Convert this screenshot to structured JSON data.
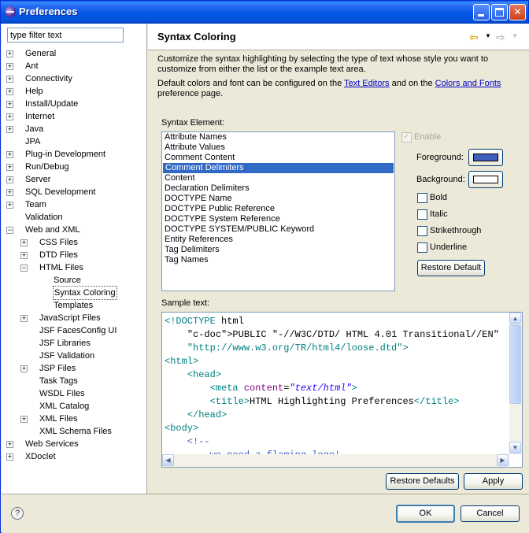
{
  "window": {
    "title": "Preferences"
  },
  "filter": {
    "placeholder": "type filter text",
    "value": "type filter text"
  },
  "tree": [
    {
      "label": "General",
      "level": 0,
      "expander": "+"
    },
    {
      "label": "Ant",
      "level": 0,
      "expander": "+"
    },
    {
      "label": "Connectivity",
      "level": 0,
      "expander": "+"
    },
    {
      "label": "Help",
      "level": 0,
      "expander": "+"
    },
    {
      "label": "Install/Update",
      "level": 0,
      "expander": "+"
    },
    {
      "label": "Internet",
      "level": 0,
      "expander": "+"
    },
    {
      "label": "Java",
      "level": 0,
      "expander": "+"
    },
    {
      "label": "JPA",
      "level": 0,
      "expander": ""
    },
    {
      "label": "Plug-in Development",
      "level": 0,
      "expander": "+"
    },
    {
      "label": "Run/Debug",
      "level": 0,
      "expander": "+"
    },
    {
      "label": "Server",
      "level": 0,
      "expander": "+"
    },
    {
      "label": "SQL Development",
      "level": 0,
      "expander": "+"
    },
    {
      "label": "Team",
      "level": 0,
      "expander": "+"
    },
    {
      "label": "Validation",
      "level": 0,
      "expander": ""
    },
    {
      "label": "Web and XML",
      "level": 0,
      "expander": "-"
    },
    {
      "label": "CSS Files",
      "level": 1,
      "expander": "+"
    },
    {
      "label": "DTD Files",
      "level": 1,
      "expander": "+"
    },
    {
      "label": "HTML Files",
      "level": 1,
      "expander": "-"
    },
    {
      "label": "Source",
      "level": 2,
      "expander": ""
    },
    {
      "label": "Syntax Coloring",
      "level": 2,
      "expander": "",
      "selected": true
    },
    {
      "label": "Templates",
      "level": 2,
      "expander": ""
    },
    {
      "label": "JavaScript Files",
      "level": 1,
      "expander": "+"
    },
    {
      "label": "JSF FacesConfig UI",
      "level": 1,
      "expander": ""
    },
    {
      "label": "JSF Libraries",
      "level": 1,
      "expander": ""
    },
    {
      "label": "JSF Validation",
      "level": 1,
      "expander": ""
    },
    {
      "label": "JSP Files",
      "level": 1,
      "expander": "+"
    },
    {
      "label": "Task Tags",
      "level": 1,
      "expander": ""
    },
    {
      "label": "WSDL Files",
      "level": 1,
      "expander": ""
    },
    {
      "label": "XML Catalog",
      "level": 1,
      "expander": ""
    },
    {
      "label": "XML Files",
      "level": 1,
      "expander": "+"
    },
    {
      "label": "XML Schema Files",
      "level": 1,
      "expander": ""
    },
    {
      "label": "Web Services",
      "level": 0,
      "expander": "+"
    },
    {
      "label": "XDoclet",
      "level": 0,
      "expander": "+"
    }
  ],
  "page": {
    "title": "Syntax Coloring",
    "desc1": "Customize the syntax highlighting by selecting the type of text whose style you want to customize from either the list or the example text area.",
    "desc2_pre": "Default colors and font can be configured on the ",
    "desc2_link1": "Text Editors",
    "desc2_mid": " and on the ",
    "desc2_link2": "Colors and Fonts",
    "desc2_post": " preference page."
  },
  "syntax": {
    "label": "Syntax Element:",
    "items": [
      "Attribute Names",
      "Attribute Values",
      "Comment Content",
      "Comment Delimiters",
      "Content",
      "Declaration Delimiters",
      "DOCTYPE Name",
      "DOCTYPE Public Reference",
      "DOCTYPE System Reference",
      "DOCTYPE SYSTEM/PUBLIC Keyword",
      "Entity References",
      "Tag Delimiters",
      "Tag Names"
    ],
    "selected_index": 3
  },
  "style": {
    "enable_label": "Enable",
    "foreground_label": "Foreground:",
    "background_label": "Background:",
    "bold_label": "Bold",
    "italic_label": "Italic",
    "strikethrough_label": "Strikethrough",
    "underline_label": "Underline",
    "restore_default_label": "Restore Default",
    "foreground_color": "#3f5fbf",
    "background_color": "#ffffff"
  },
  "sample": {
    "label": "Sample text:",
    "lines": [
      "<!DOCTYPE html",
      "    PUBLIC \"-//W3C/DTD/ HTML 4.01 Transitional//EN\"",
      "    \"http://www.w3.org/TR/html4/loose.dtd\">",
      "<html>",
      "    <head>",
      "        <meta content=\"text/html\">",
      "        <title>HTML Highlighting Preferences</title>",
      "    </head>",
      "<body>",
      "    <!--",
      "        we need a flaming logo!"
    ]
  },
  "buttons": {
    "restore_defaults": "Restore Defaults",
    "apply": "Apply",
    "ok": "OK",
    "cancel": "Cancel"
  },
  "icons": {
    "title": "eclipse-icon",
    "help": "help-icon",
    "back": "back-arrow-icon",
    "forward": "forward-arrow-icon"
  }
}
